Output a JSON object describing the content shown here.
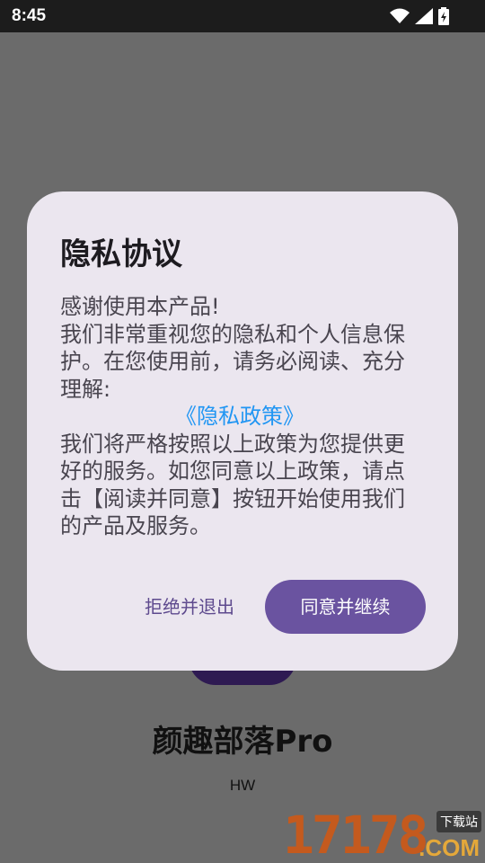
{
  "status_bar": {
    "time": "8:45",
    "icons": [
      "wifi-icon",
      "signal-icon",
      "battery-charging-icon"
    ]
  },
  "background": {
    "app_name": "颜趣部落Pro",
    "author": "HW",
    "scrim_color": "#6b6b6b",
    "button_color": "#2e1a52"
  },
  "dialog": {
    "title": "隐私协议",
    "body_line1": "感谢使用本产品!",
    "body_line2": "我们非常重视您的隐私和个人信息保护。在您使用前，请务必阅读、充分理解:",
    "policy_link": "《隐私政策》",
    "body_line3": "我们将严格按照以上政策为您提供更好的服务。如您同意以上政策，请点击【阅读并同意】按钮开始使用我们的产品及服务。",
    "reject_label": "拒绝并退出",
    "accept_label": "同意并继续",
    "accent_color": "#6a53a0",
    "link_color": "#2196f3"
  },
  "watermark": {
    "number": "17178",
    "tag": "下载站",
    "domain": ".COM"
  }
}
